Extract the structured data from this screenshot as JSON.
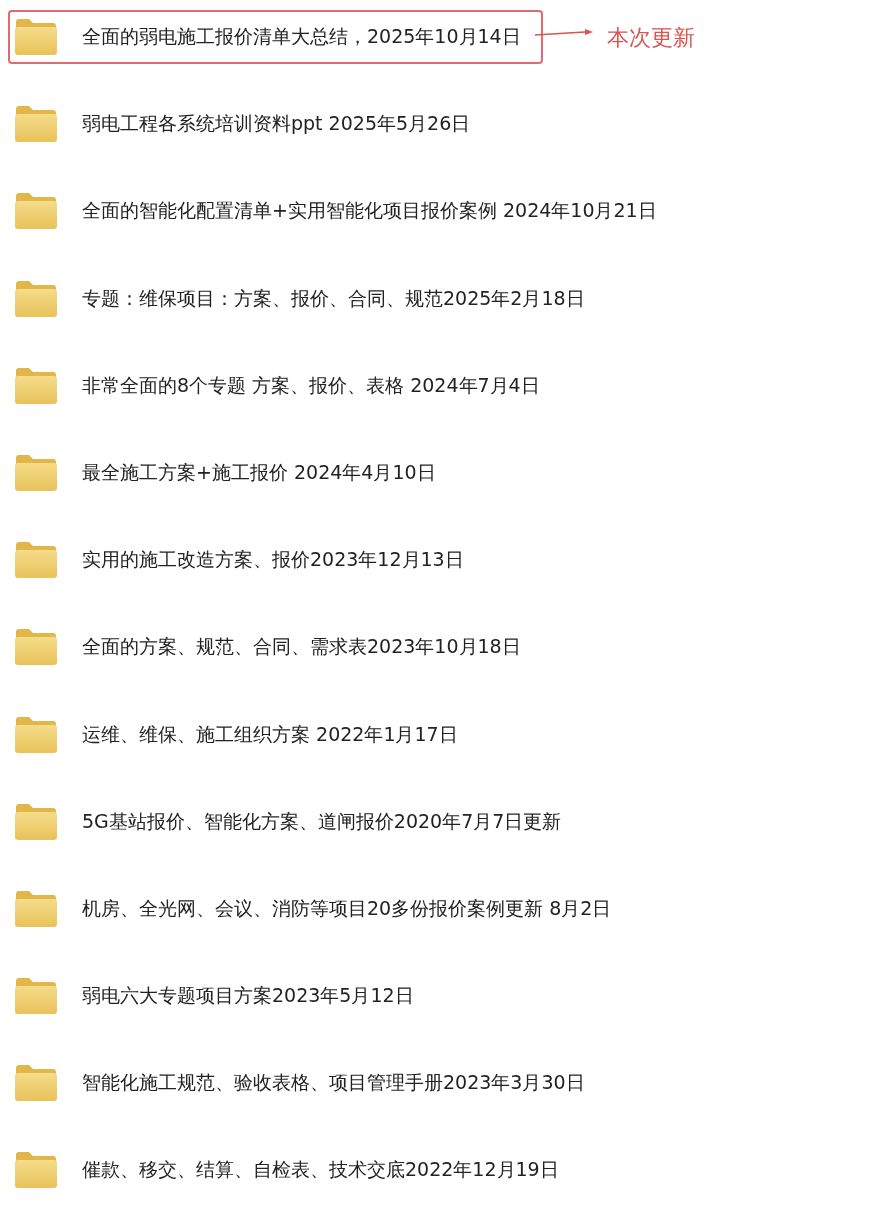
{
  "folders": [
    {
      "name": "全面的弱电施工报价清单大总结，2025年10月14日",
      "highlighted": true
    },
    {
      "name": "弱电工程各系统培训资料ppt 2025年5月26日",
      "highlighted": false
    },
    {
      "name": "全面的智能化配置清单+实用智能化项目报价案例 2024年10月21日",
      "highlighted": false
    },
    {
      "name": "专题：维保项目：方案、报价、合同、规范2025年2月18日",
      "highlighted": false
    },
    {
      "name": "非常全面的8个专题 方案、报价、表格 2024年7月4日",
      "highlighted": false
    },
    {
      "name": "最全施工方案+施工报价 2024年4月10日",
      "highlighted": false
    },
    {
      "name": "实用的施工改造方案、报价2023年12月13日",
      "highlighted": false
    },
    {
      "name": "全面的方案、规范、合同、需求表2023年10月18日",
      "highlighted": false
    },
    {
      "name": "运维、维保、施工组织方案 2022年1月17日",
      "highlighted": false
    },
    {
      "name": "5G基站报价、智能化方案、道闸报价2020年7月7日更新",
      "highlighted": false
    },
    {
      "name": "机房、全光网、会议、消防等项目20多份报价案例更新 8月2日",
      "highlighted": false
    },
    {
      "name": "弱电六大专题项目方案2023年5月12日",
      "highlighted": false
    },
    {
      "name": "智能化施工规范、验收表格、项目管理手册2023年3月30日",
      "highlighted": false
    },
    {
      "name": "催款、移交、结算、自检表、技术交底2022年12月19日",
      "highlighted": false
    }
  ],
  "annotation": {
    "text": "本次更新"
  }
}
